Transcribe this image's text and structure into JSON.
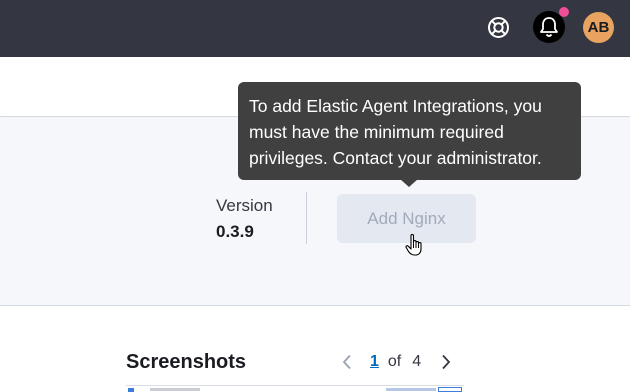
{
  "topbar": {
    "avatar_initials": "AB",
    "icons": [
      "help-icon",
      "bell-icon"
    ],
    "notification_dot_color": "#f04e98"
  },
  "package": {
    "version_label": "Version",
    "version_value": "0.3.9",
    "add_button_label": "Add Nginx",
    "add_button_disabled": true
  },
  "tooltip": {
    "text": "To add Elastic Agent Integrations, you must have the minimum required privileges. Contact your administrator."
  },
  "screenshots": {
    "title": "Screenshots",
    "current_page": "1",
    "of_label": "of",
    "total_pages": "4"
  },
  "colors": {
    "topbar_bg": "#343741",
    "avatar_bg": "#e7a35f",
    "link_blue": "#006bb8"
  }
}
